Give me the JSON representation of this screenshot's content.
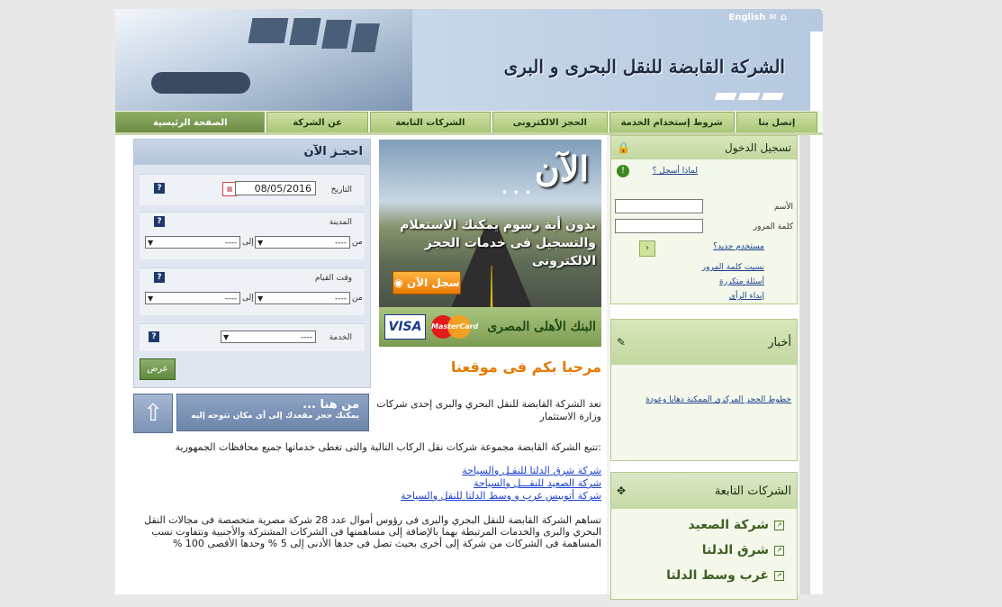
{
  "header": {
    "english_link": "English",
    "mail_icon": "mail-icon",
    "home_icon": "home-icon",
    "title": "الشركة القابضة للنقل البحرى و البرى"
  },
  "nav": {
    "items": [
      {
        "label": "الصفحة الرئيسية",
        "active": true
      },
      {
        "label": "عن الشركة"
      },
      {
        "label": "الشركات التابعة"
      },
      {
        "label": "الحجز الالكترونى"
      },
      {
        "label": "شروط إستخدام الخدمة"
      },
      {
        "label": "إتصل بنا"
      }
    ]
  },
  "login": {
    "title": "تسجيل الدخول",
    "why_register": "لماذا أسجل ؟",
    "name_label": "الأسم",
    "password_label": "كلمة المرور",
    "new_user": "مستخدم جديد؟",
    "forgot_password": "نسيت كلمة المرور",
    "faq": "أسئلة متكررة",
    "feedback": "إبداء الرأى"
  },
  "news": {
    "title": "أخبار",
    "item": "خطوط الحجز المركزى الممكنة ذهابا وعودة"
  },
  "subsidiaries": {
    "title": "الشركات التابعة",
    "items": [
      "شركة الصعيد",
      "شرق الدلتا",
      "غرب وسط الدلتا"
    ]
  },
  "banner": {
    "big": "الآن",
    "dots": ". . .",
    "sub": "بدون أية رسوم يمكنك الاستعلام والتسجيل فى خدمات الحجز الالكترونى",
    "button": "سجل الآن",
    "visa": "VISA",
    "mastercard": "MasterCard",
    "bank": "البنك الأهلى المصرى"
  },
  "welcome": "مرحبا بكم فى موقعنا",
  "intro": "تعد الشركة القابضة للنقل البحري والبرى إحدى شركات وزارة الاستثمار",
  "lower": {
    "follow_text": ":تتبع الشركة القابضة مجموعة شركات نقل الركاب التالية والتى تغطى خدماتها جميع محافظات الجمهورية",
    "links": [
      "شركة شرق الدلتا للنقـل والسياحة",
      "شركة الصعيد للنقـــل والسياحة",
      "شركة أتوبيس غرب و وسط الدلتا للنقل والسياحة"
    ],
    "paragraph": "تساهم الشركة القابضة للنقل البحري والبرى فى رؤوس أموال عدد 28 شركة مصرية متخصصة فى مجالات النقل البحري والبرى والخدمات المرتبطة بهما بالإضافة إلى مساهمتها فى الشركات المشتركة والأجنبية وتتفاوت نسب المساهمة فى الشركات من شركة إلى أخرى بحيث تصل فى حدها الأدنى إلى 5 % وحدها الأقصى 100 %"
  },
  "booking": {
    "title": "احجـز الآن",
    "date_label": "التاريخ",
    "date_value": "08/05/2016",
    "city_label": "المدينة",
    "time_label": "وقت القيام",
    "from_label": "من",
    "to_label": "إلى",
    "service_label": "الخدمة",
    "select_placeholder": "----",
    "show_button": "عرض"
  },
  "from_here": {
    "title": "من هنا ...",
    "sub": "يمكنك حجز مقعدك إلى أى مكان تتوجه إليه"
  }
}
